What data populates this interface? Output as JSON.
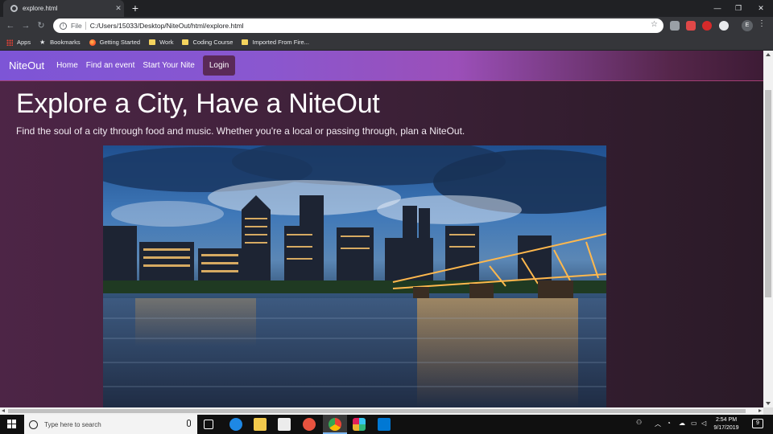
{
  "browser": {
    "tab_title": "explore.html",
    "tab_close": "✕",
    "new_tab": "+",
    "scheme_label": "File",
    "url": "C:/Users/15033/Desktop/NiteOut/html/explore.html",
    "profile_initial": "E",
    "window_controls": [
      "—",
      "❐",
      "✕"
    ],
    "bookmarks": [
      {
        "label": "Apps",
        "icon": "apps-grid-icon"
      },
      {
        "label": "Bookmarks",
        "icon": "star-icon"
      },
      {
        "label": "Getting Started",
        "icon": "firefox-icon"
      },
      {
        "label": "Work",
        "icon": "folder-icon"
      },
      {
        "label": "Coding Course",
        "icon": "folder-icon"
      },
      {
        "label": "Imported From Fire...",
        "icon": "folder-icon"
      }
    ]
  },
  "site": {
    "brand": "NiteOut",
    "nav": [
      "Home",
      "Find an event",
      "Start Your Nite"
    ],
    "login": "Login",
    "hero_title": "Explore a City, Have a NiteOut",
    "hero_subtitle": "Find the soul of a city through food and music. Whether you're a local or passing through, plan a NiteOut."
  },
  "taskbar": {
    "search_placeholder": "Type here to search",
    "time": "2:54 PM",
    "date": "9/17/2019",
    "notification_count": "9"
  },
  "colors": {
    "nav_gradient_start": "#7d55d6",
    "page_background": "#3e2139",
    "login_button": "#5a2a58"
  }
}
